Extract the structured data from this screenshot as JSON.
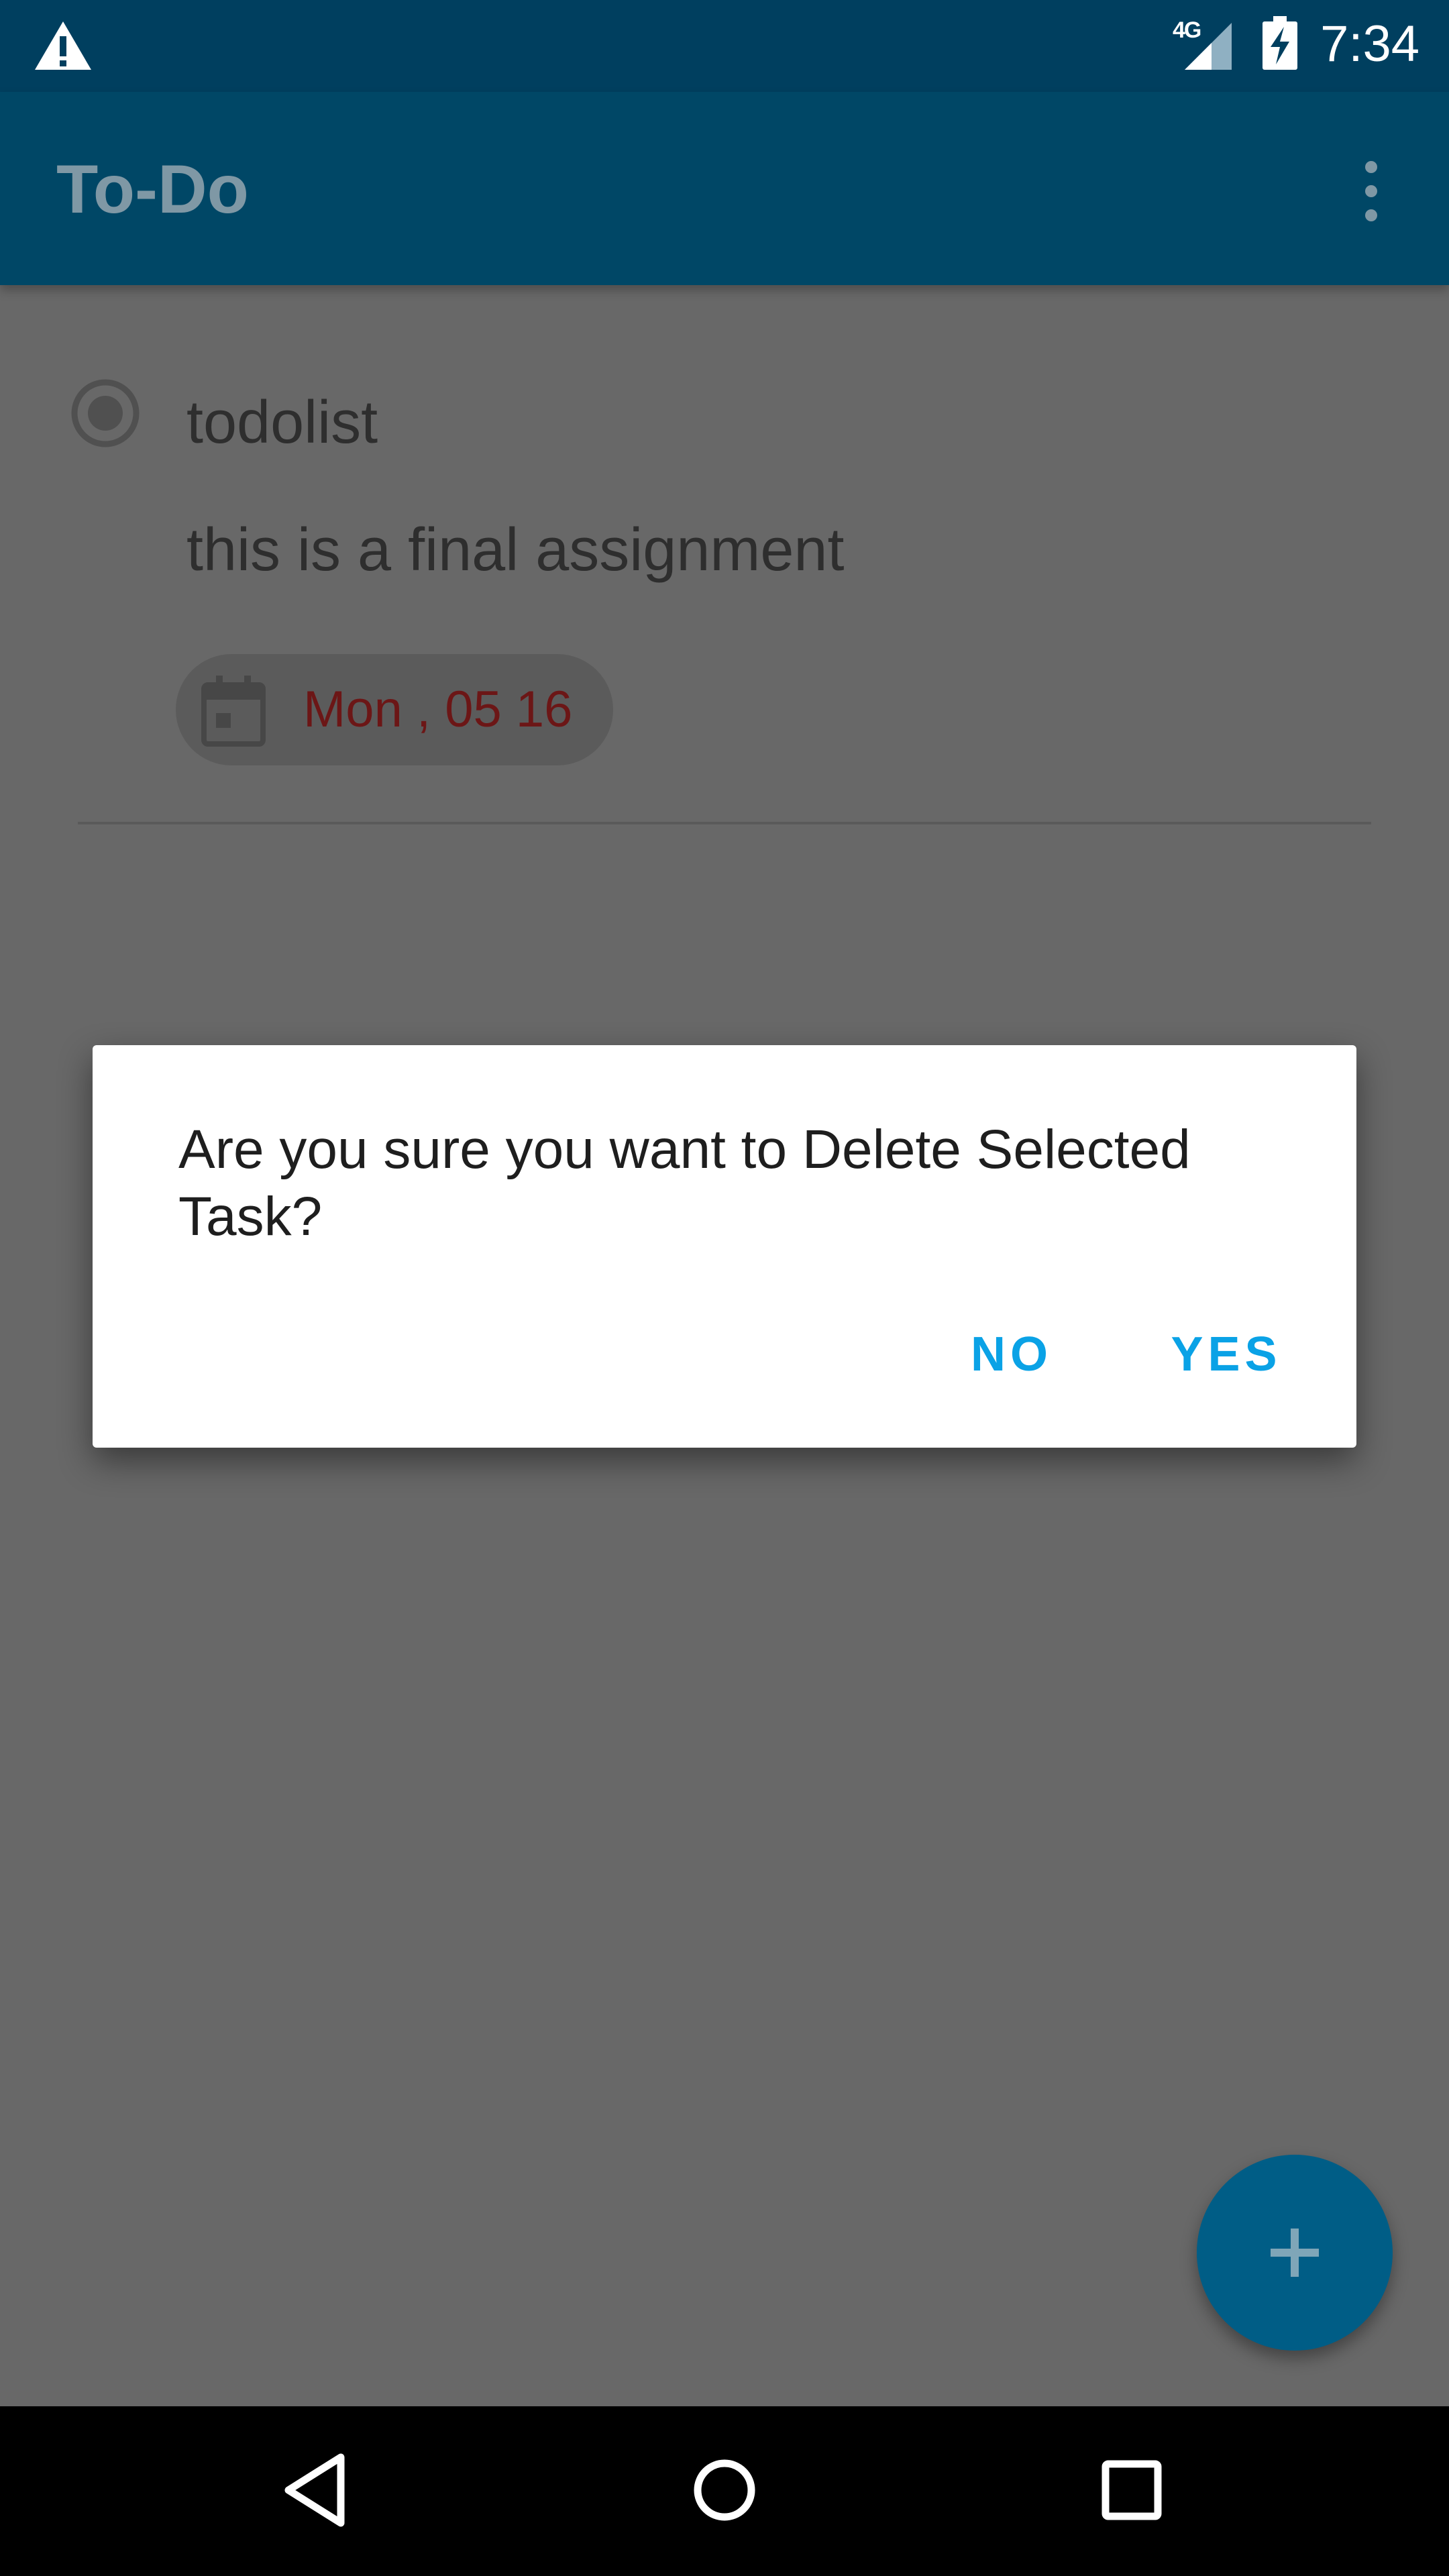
{
  "status_bar": {
    "time": "7:34",
    "network": "4G",
    "icons": [
      "warning-icon",
      "signal-icon",
      "battery-charging-icon"
    ]
  },
  "app_bar": {
    "title": "To-Do",
    "menu_icon": "more-vert-icon"
  },
  "task": {
    "title": "todolist",
    "description": "this is a final assignment",
    "date": "Mon , 05 16",
    "date_icon": "calendar-icon",
    "date_color": "#6c1616"
  },
  "dialog": {
    "message": "Are you sure you want to Delete Selected Task?",
    "no_label": "NO",
    "yes_label": "YES",
    "accent": "#0aa2e6"
  },
  "fab": {
    "icon": "plus-icon",
    "color": "#005d86"
  },
  "nav_bar": {
    "icons": [
      "back-icon",
      "home-icon",
      "recent-apps-icon"
    ]
  },
  "colors": {
    "primary": "#004766",
    "status_bar": "#003f5f",
    "scrim_background": "#686868"
  }
}
